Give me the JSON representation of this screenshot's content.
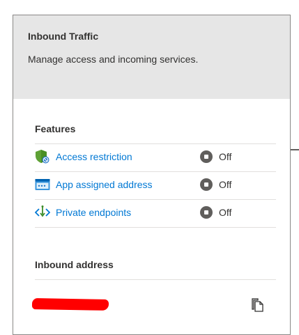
{
  "panel": {
    "title": "Inbound Traffic",
    "description": "Manage access and incoming services."
  },
  "features": {
    "heading": "Features",
    "items": [
      {
        "label": "Access restriction",
        "icon": "shield-icon",
        "status": "Off"
      },
      {
        "label": "App assigned address",
        "icon": "app-address-icon",
        "status": "Off"
      },
      {
        "label": "Private endpoints",
        "icon": "private-endpoint-icon",
        "status": "Off"
      }
    ]
  },
  "inbound_address": {
    "heading": "Inbound address",
    "value_redacted": true,
    "copy_icon": "copy-icon"
  },
  "colors": {
    "header_bg": "#e6e6e6",
    "link": "#0078d4",
    "status_icon": "#605e5c",
    "redaction": "#ff0000"
  }
}
